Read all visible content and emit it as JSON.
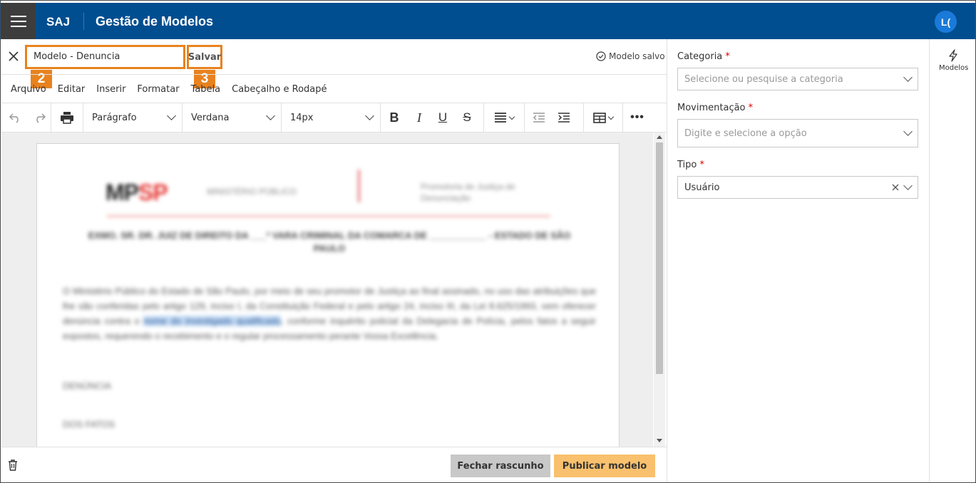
{
  "header": {
    "brand": "SAJ",
    "title": "Gestão de Modelos",
    "avatar": "L("
  },
  "document": {
    "name_value": "Modelo - Denuncia",
    "save_label": "Salvar",
    "status": "Modelo salvo",
    "callout_name": "2",
    "callout_save": "3"
  },
  "menubar": [
    "Arquivo",
    "Editar",
    "Inserir",
    "Formatar",
    "Tabela",
    "Cabeçalho e Rodapé"
  ],
  "toolbar": {
    "block_format": "Parágrafo",
    "font_family": "Verdana",
    "font_size": "14px"
  },
  "editor_content": {
    "logo_left": "MP",
    "logo_red": "SP",
    "logo_sub": "MINISTÉRIO PÚBLICO",
    "logo_right": "Promotoria de Justiça de Denunciação",
    "heading": "EXMO. SR. DR. JUIZ DE DIREITO DA ___ª VARA CRIMINAL DA COMARCA DE ___________ - ESTADO DE SÃO PAULO",
    "body_before": "O Ministério Público do Estado de São Paulo, por meio de seu promotor de Justiça ao final assinado, no uso das atribuições que lhe são conferidas pelo artigo 129, inciso I, da Constituição Federal e pelo artigo 24, inciso III, da Lei 8.625/1993, vem oferecer denúncia contra o ",
    "body_highlight": "nome do investigado qualificado",
    "body_after": ", conforme inquérito policial da Delegacia de Polícia, pelos fatos a seguir expostos, requerendo o recebimento e o regular processamento perante Vossa Excelência.",
    "p2": "DENÚNCIA",
    "p3": "DOS FATOS"
  },
  "footer": {
    "close_draft": "Fechar rascunho",
    "publish": "Publicar modelo"
  },
  "form": {
    "categoria_label": "Categoria",
    "categoria_placeholder": "Selecione ou pesquise a categoria",
    "movimentacao_label": "Movimentação",
    "movimentacao_placeholder": "Digite e selecione a opção",
    "tipo_label": "Tipo",
    "tipo_value": "Usuário",
    "required_mark": "*"
  },
  "side_panel": {
    "models_label": "Modelos"
  },
  "colors": {
    "header_bg": "#004e8f",
    "menu_btn_bg": "#3d3d3d",
    "highlight_orange": "#e8821e",
    "publish_bg": "#f9c06d",
    "close_bg": "#c8c8c8",
    "avatar_bg": "#1a7ad9"
  }
}
